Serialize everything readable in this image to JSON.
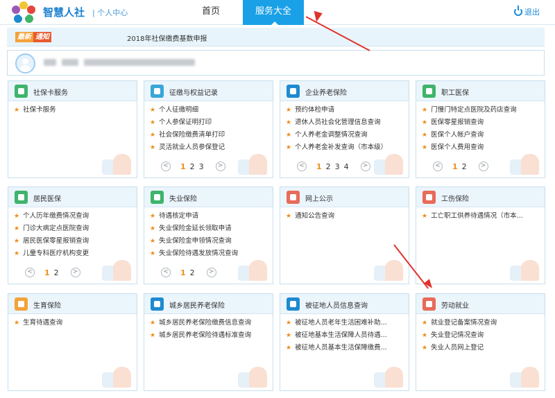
{
  "header": {
    "brand": "智慧人社",
    "sub": "| 个人中心",
    "nav_home": "首页",
    "nav_active": "服务大全",
    "logout": "退出"
  },
  "notice": {
    "badge_1": "最新",
    "badge_2": "通知",
    "text": "2018年社保缴费基数申报"
  },
  "cards": [
    {
      "title": "社保卡服务",
      "icon_color": "#3fb46b",
      "icon": "card-icon",
      "items": [
        "社保卡服务"
      ],
      "pager": null
    },
    {
      "title": "征缴与权益记录",
      "icon_color": "#3aa6d8",
      "icon": "search-person-icon",
      "items": [
        "个人征缴明细",
        "个人参保证明打印",
        "社会保险缴费清单打印",
        "灵活就业人员参保登记"
      ],
      "pager": {
        "current": "1",
        "pages": [
          "2",
          "3"
        ]
      }
    },
    {
      "title": "企业养老保险",
      "icon_color": "#1e8ad0",
      "icon": "elder-icon",
      "items": [
        "预约体检申请",
        "退休人员社会化管理信息查询",
        "个人养老金调整情况查询",
        "个人养老金补发查询（市本级）"
      ],
      "pager": {
        "current": "1",
        "pages": [
          "2",
          "3",
          "4"
        ]
      }
    },
    {
      "title": "职工医保",
      "icon_color": "#3fb46b",
      "icon": "medical-icon",
      "items": [
        "门慢门特定点医院及药店查询",
        "医保零星报销查询",
        "医保个人帐户查询",
        "医保个人费用查询"
      ],
      "pager": {
        "current": "1",
        "pages": [
          "2"
        ]
      }
    },
    {
      "title": "居民医保",
      "icon_color": "#3fb46b",
      "icon": "medical-icon",
      "items": [
        "个人历年缴费情况查询",
        "门诊大病定点医院查询",
        "居民医保零星报销查询",
        "儿童专科医疗机构变更"
      ],
      "pager": {
        "current": "1",
        "pages": [
          "2"
        ]
      }
    },
    {
      "title": "失业保险",
      "icon_color": "#3fb46b",
      "icon": "umbrella-icon",
      "items": [
        "待遇核定申请",
        "失业保险金延长领取申请",
        "失业保险金申领情况查询",
        "失业保险待遇发放情况查询"
      ],
      "pager": {
        "current": "1",
        "pages": [
          "2"
        ]
      }
    },
    {
      "title": "网上公示",
      "icon_color": "#e86b5a",
      "icon": "notice-icon",
      "items": [
        "通知公告查询"
      ],
      "pager": null
    },
    {
      "title": "工伤保险",
      "icon_color": "#e86b5a",
      "icon": "injury-icon",
      "items": [
        "工亡职工供养待遇情况（市本..."
      ],
      "pager": null
    },
    {
      "title": "生育保险",
      "icon_color": "#f3a33a",
      "icon": "baby-icon",
      "items": [
        "生育待遇查询"
      ],
      "pager": null
    },
    {
      "title": "城乡居民养老保险",
      "icon_color": "#1e8ad0",
      "icon": "elder-icon",
      "items": [
        "城乡居民养老保险缴费信息查询",
        "城乡居民养老保险待遇标准查询"
      ],
      "pager": null
    },
    {
      "title": "被征地人员信息查询",
      "icon_color": "#1e8ad0",
      "icon": "land-icon",
      "items": [
        "被征地人员老年生活困难补助...",
        "被征地基本生活保障人员待遇...",
        "被征地人员基本生活保障缴费..."
      ],
      "pager": null
    },
    {
      "title": "劳动就业",
      "icon_color": "#e86b5a",
      "icon": "worker-icon",
      "items": [
        "就业登记备案情况查询",
        "失业登记情况查询",
        "失业人员网上登记"
      ],
      "pager": null
    }
  ]
}
